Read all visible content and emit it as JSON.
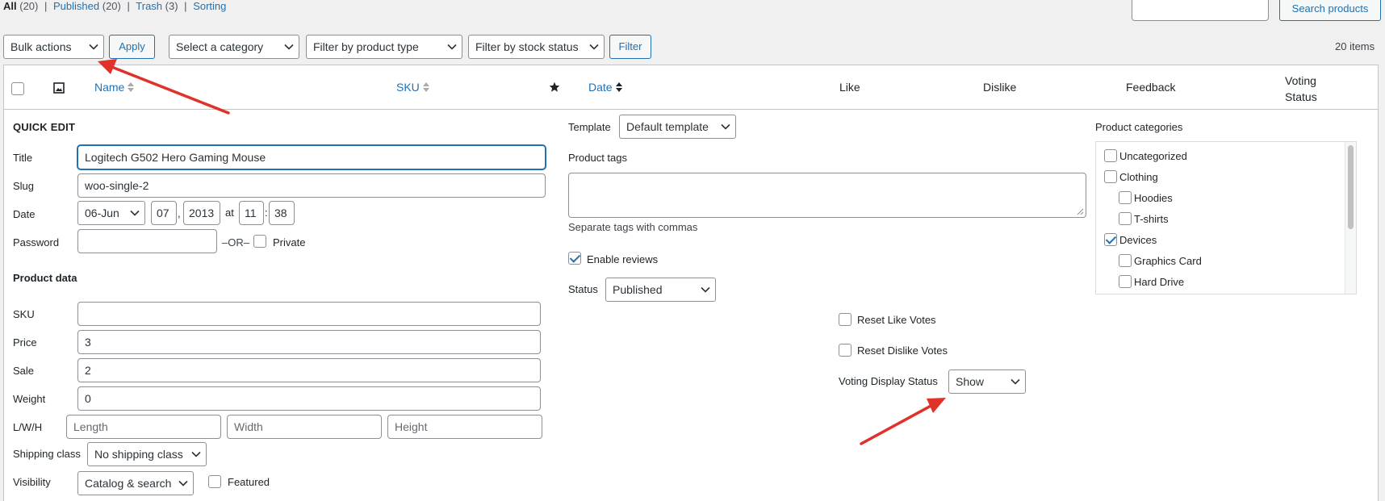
{
  "subsubsub": {
    "all_label": "All",
    "all_count": "(20)",
    "published_label": "Published",
    "published_count": "(20)",
    "trash_label": "Trash",
    "trash_count": "(3)",
    "sorting_label": "Sorting",
    "sep": "|"
  },
  "search": {
    "button_label": "Search products",
    "value": ""
  },
  "tablenav": {
    "bulk_actions": "Bulk actions",
    "apply": "Apply",
    "category": "Select a category",
    "product_type": "Filter by product type",
    "stock_status": "Filter by stock status",
    "filter": "Filter",
    "items_count": "20 items"
  },
  "table_headers": {
    "name": "Name",
    "sku": "SKU",
    "date": "Date",
    "like": "Like",
    "dislike": "Dislike",
    "feedback": "Feedback",
    "voting_status_1": "Voting",
    "voting_status_2": "Status"
  },
  "quick_edit": {
    "heading": "QUICK EDIT",
    "title_label": "Title",
    "title_value": "Logitech G502 Hero Gaming Mouse",
    "slug_label": "Slug",
    "slug_value": "woo-single-2",
    "date_label": "Date",
    "month": "06-Jun",
    "day": "07",
    "comma": ",",
    "year": "2013",
    "at": "at",
    "hour": "11",
    "colon": ":",
    "minute": "38",
    "password_label": "Password",
    "password_value": "",
    "or_text": "–OR–",
    "private_label": "Private",
    "product_data_heading": "Product data",
    "sku_label": "SKU",
    "sku_value": "",
    "price_label": "Price",
    "price_value": "3",
    "sale_label": "Sale",
    "sale_value": "2",
    "weight_label": "Weight",
    "weight_value": "0",
    "lwh_label": "L/W/H",
    "length_placeholder": "Length",
    "width_placeholder": "Width",
    "height_placeholder": "Height",
    "shipping_label": "Shipping class",
    "shipping_value": "No shipping class",
    "visibility_label": "Visibility",
    "visibility_value": "Catalog & search",
    "featured_label": "Featured"
  },
  "middle": {
    "template_label": "Template",
    "template_value": "Default template",
    "tags_label": "Product tags",
    "tags_value": "",
    "tags_hint": "Separate tags with commas",
    "enable_reviews": "Enable reviews",
    "status_label": "Status",
    "status_value": "Published",
    "reset_like": "Reset Like Votes",
    "reset_dislike": "Reset Dislike Votes",
    "voting_display_label": "Voting Display Status",
    "voting_display_value": "Show"
  },
  "categories": {
    "heading": "Product categories",
    "items": [
      {
        "label": "Uncategorized",
        "checked": false,
        "level": 0
      },
      {
        "label": "Clothing",
        "checked": false,
        "level": 0
      },
      {
        "label": "Hoodies",
        "checked": false,
        "level": 1
      },
      {
        "label": "T-shirts",
        "checked": false,
        "level": 1
      },
      {
        "label": "Devices",
        "checked": true,
        "level": 0
      },
      {
        "label": "Graphics Card",
        "checked": false,
        "level": 1
      },
      {
        "label": "Hard Drive",
        "checked": false,
        "level": 1
      }
    ]
  },
  "colors": {
    "accent": "#2271b1",
    "arrow": "#e0312a",
    "background": "#f0f0f1"
  }
}
